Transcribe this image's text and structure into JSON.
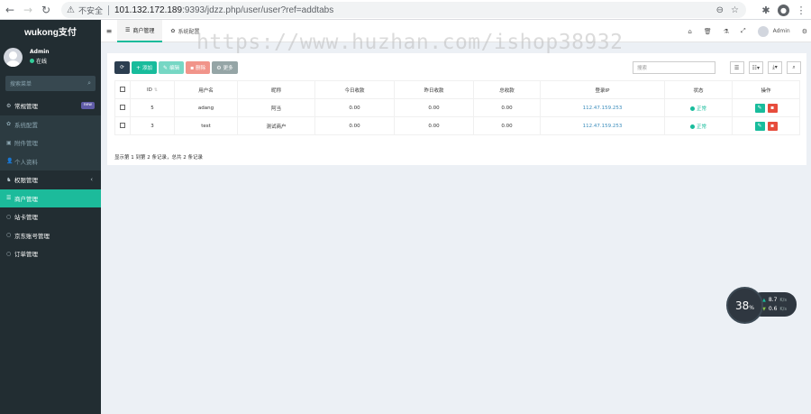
{
  "browser": {
    "back_icon": "back-arrow-icon",
    "insecure_label": "不安全",
    "url_host": "101.132.172.189",
    "url_rest": ":9393/jdzz.php/user/user?ref=addtabs"
  },
  "sidebar": {
    "logo": "wukong支付",
    "user_name": "Admin",
    "user_status": "在线",
    "search_placeholder": "搜索菜单",
    "items": [
      {
        "label": "常规管理",
        "icon": "cogs-icon",
        "type": "top",
        "badge": "new"
      },
      {
        "label": "系统配置",
        "icon": "gear-icon",
        "type": "sub"
      },
      {
        "label": "附件管理",
        "icon": "image-icon",
        "type": "sub"
      },
      {
        "label": "个人资料",
        "icon": "user-icon",
        "type": "sub"
      },
      {
        "label": "权限管理",
        "icon": "group-icon",
        "type": "top",
        "caret": "‹"
      },
      {
        "label": "商户管理",
        "icon": "list-icon",
        "type": "active"
      },
      {
        "label": "站卡管理",
        "icon": "circle-icon",
        "type": "top"
      },
      {
        "label": "京东账号管理",
        "icon": "circle-icon",
        "type": "top"
      },
      {
        "label": "订单管理",
        "icon": "circle-icon",
        "type": "top"
      }
    ]
  },
  "navbar": {
    "tabs": [
      {
        "label": "商户管理",
        "icon": "list-icon",
        "active": true
      },
      {
        "label": "系统配置",
        "icon": "gear-icon",
        "active": false
      }
    ],
    "admin_label": "Admin"
  },
  "toolbar": {
    "add_label": "添加",
    "edit_label": "编辑",
    "delete_label": "删除",
    "more_label": "更多",
    "search_placeholder": "搜索"
  },
  "table": {
    "headers": [
      "",
      "ID",
      "用户名",
      "昵称",
      "今日收款",
      "昨日收款",
      "总收款",
      "登录IP",
      "状态",
      "操作"
    ],
    "rows": [
      {
        "id": "5",
        "username": "adang",
        "nickname": "阿当",
        "today": "0.00",
        "yesterday": "0.00",
        "total": "0.00",
        "ip": "112.47.159.253",
        "status": "正常"
      },
      {
        "id": "3",
        "username": "test",
        "nickname": "测试商户",
        "today": "0.00",
        "yesterday": "0.00",
        "total": "0.00",
        "ip": "112.47.159.253",
        "status": "正常"
      }
    ],
    "page_info": "显示第 1 到第 2 条记录，总共 2 条记录"
  },
  "watermark": "https://www.huzhan.com/ishop38932",
  "speed_widget": {
    "percent": "38",
    "percent_unit": "%",
    "up_value": "8.7",
    "up_unit": "K/s",
    "down_value": "0.6",
    "down_unit": "K/s"
  },
  "colors": {
    "accent": "#1cbb9b",
    "sidebar_bg": "#222d32",
    "danger": "#e74c3c",
    "link": "#3c8dbc"
  }
}
